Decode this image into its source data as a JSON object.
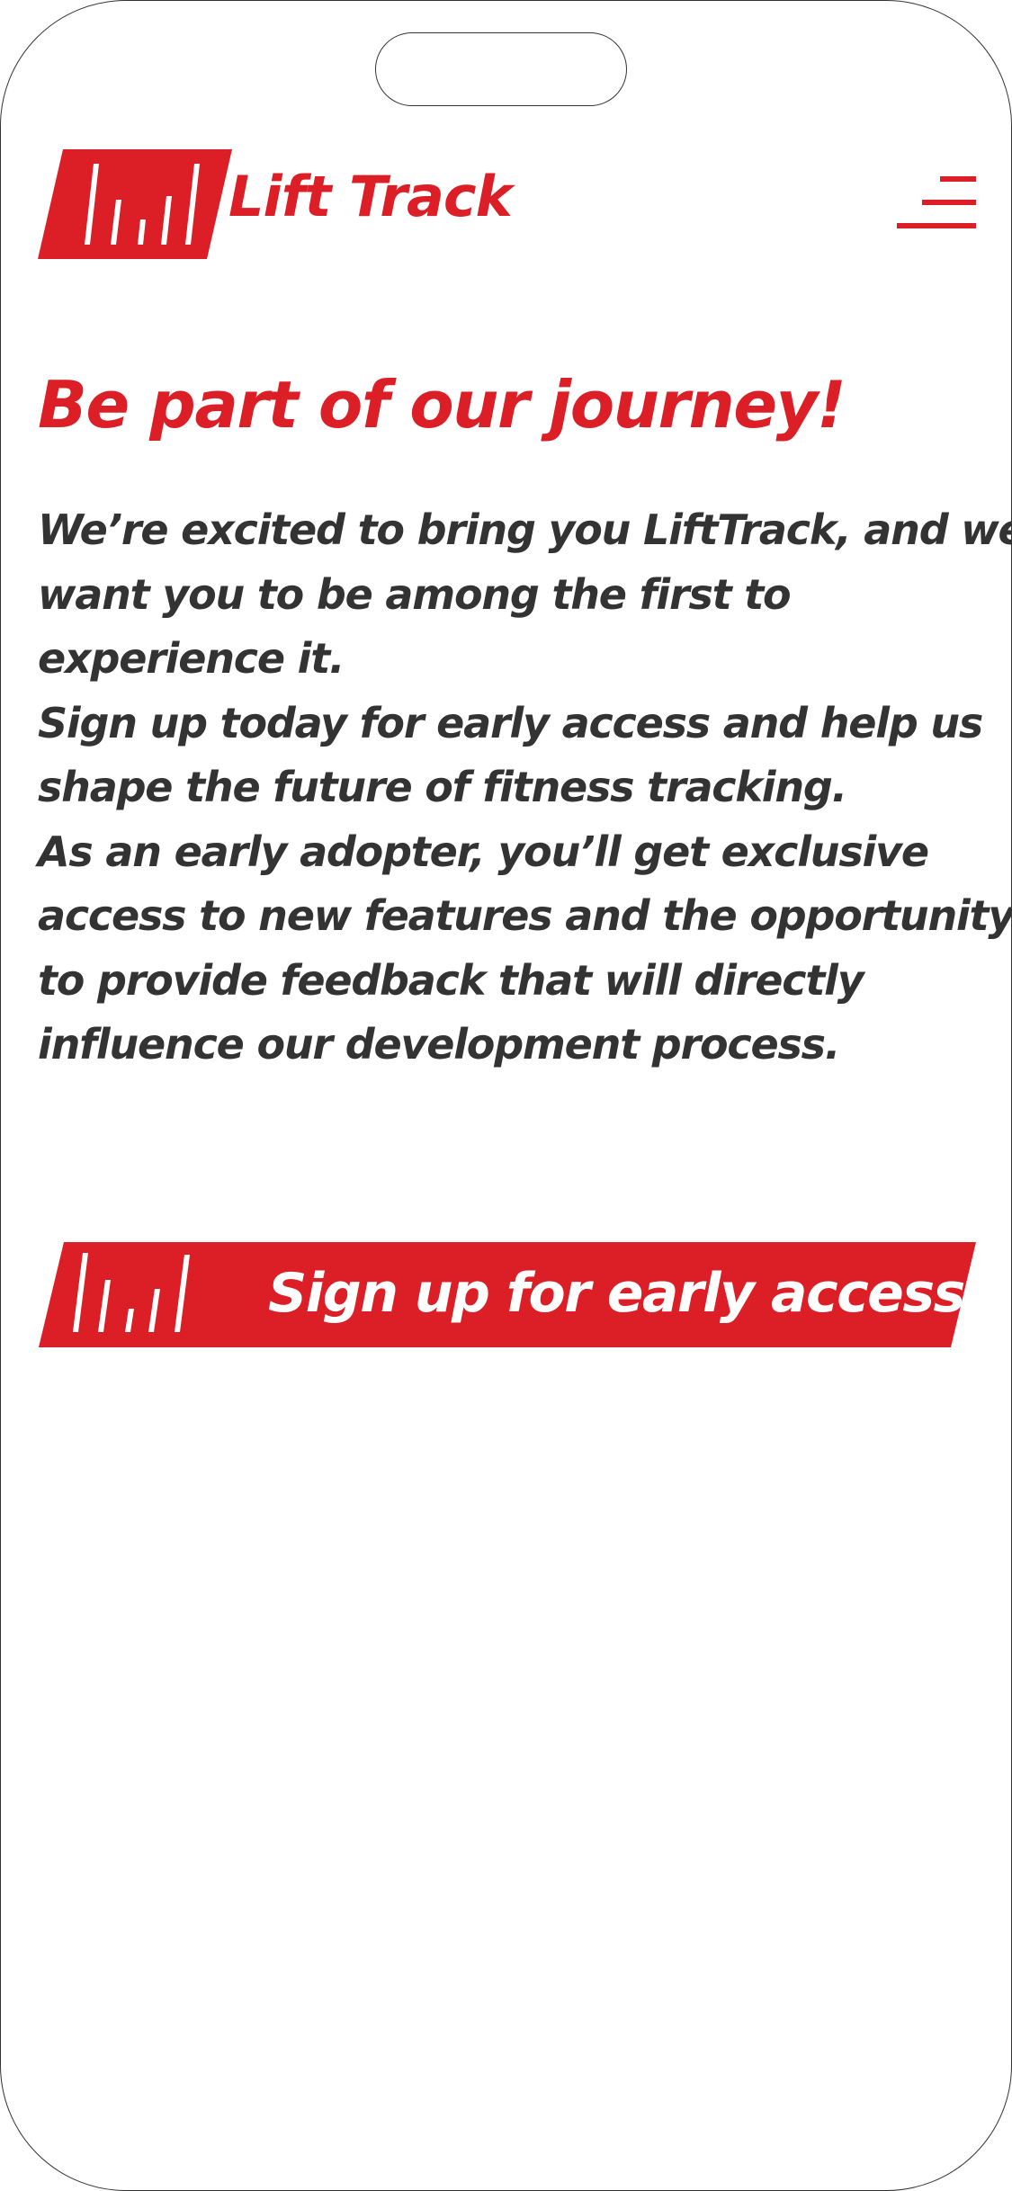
{
  "colors": {
    "brand_red": "#dc1f26",
    "body_text": "#333333",
    "background": "#ffffff"
  },
  "header": {
    "logo_icon": "bar-chart-logo-icon",
    "brand_name": "Lift Track",
    "menu_icon": "hamburger-menu-icon"
  },
  "main": {
    "headline": "Be part of our journey!",
    "intro_lines": [
      "We’re excited to bring you LiftTrack, and we",
      "want you to be among the first to",
      "experience it.",
      "Sign up today for early access and help us",
      "shape the future of fitness tracking.",
      "As an early adopter, you’ll get exclusive",
      "access to new features and the opportunity",
      "to provide feedback that will directly",
      "influence our development process."
    ]
  },
  "cta": {
    "icon": "bar-chart-icon",
    "label": "Sign up for early access"
  }
}
